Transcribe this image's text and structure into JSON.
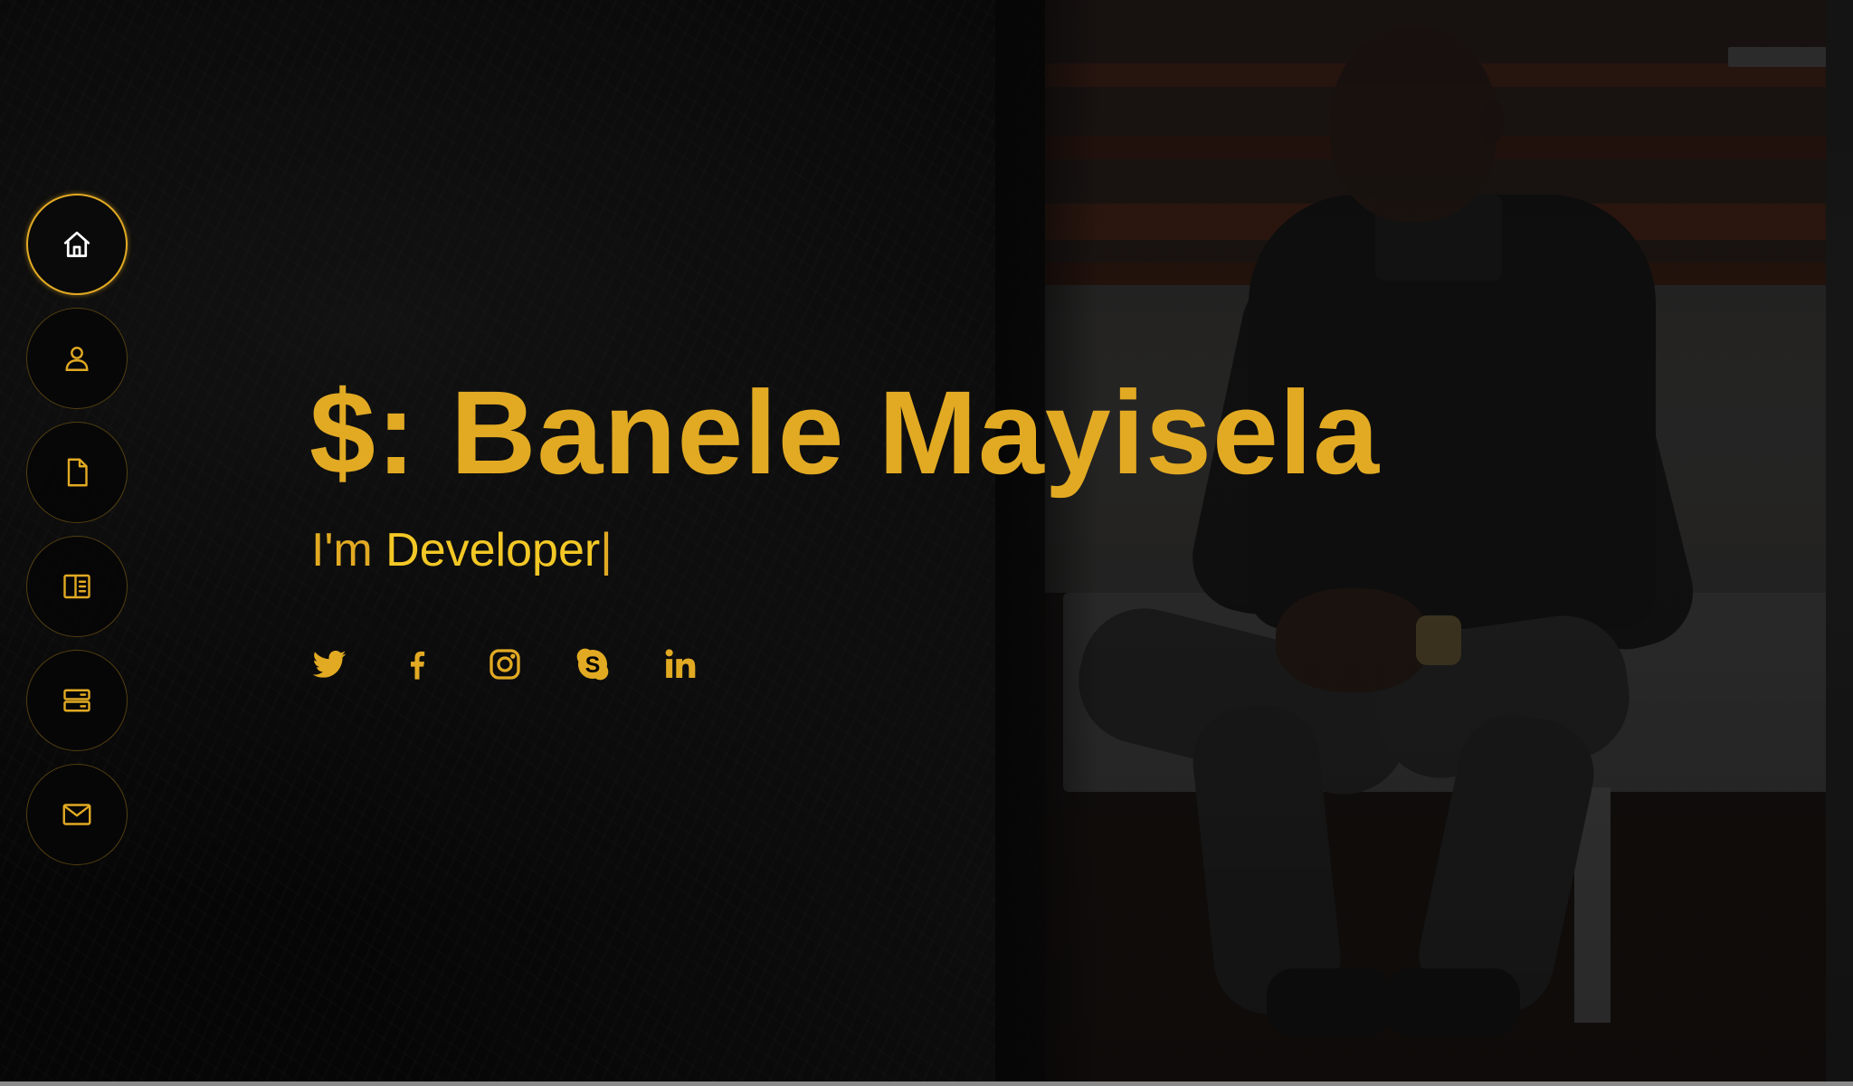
{
  "hero": {
    "title": "$: Banele Mayisela",
    "subtitle_prefix": "I'm",
    "subtitle_typed": "Developer",
    "cursor": "|"
  },
  "nav": {
    "items": [
      {
        "icon": "home-icon",
        "active": true
      },
      {
        "icon": "person-icon",
        "active": false
      },
      {
        "icon": "file-icon",
        "active": false
      },
      {
        "icon": "book-half-icon",
        "active": false
      },
      {
        "icon": "server-icon",
        "active": false
      },
      {
        "icon": "envelope-icon",
        "active": false
      }
    ]
  },
  "social": {
    "links": [
      {
        "icon": "twitter-icon"
      },
      {
        "icon": "facebook-icon"
      },
      {
        "icon": "instagram-icon"
      },
      {
        "icon": "skype-icon"
      },
      {
        "icon": "linkedin-icon"
      }
    ]
  },
  "theme": {
    "accent": "#e2aa23",
    "typed_text": "#f3c826",
    "background": "#060606"
  }
}
